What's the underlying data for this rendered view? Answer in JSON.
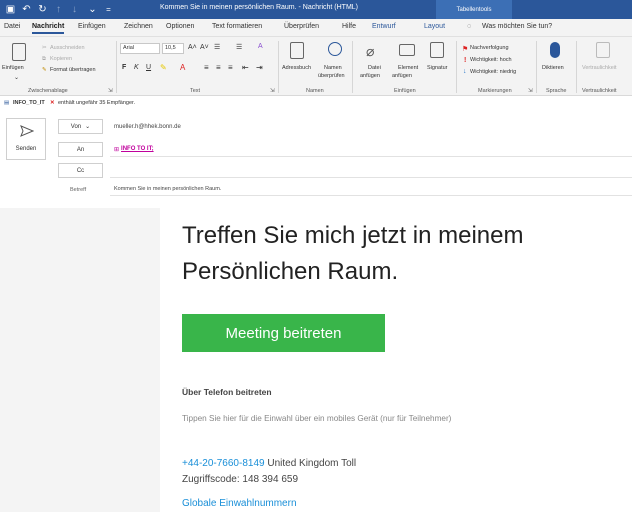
{
  "window": {
    "title": "Kommen Sie in meinen persönlichen Raum.  -  Nachricht (HTML)",
    "tool_tab": "Tabellentools"
  },
  "tabs": [
    "Datei",
    "Nachricht",
    "Einfügen",
    "Zeichnen",
    "Optionen",
    "Text formatieren",
    "Überprüfen",
    "Hilfe",
    "Entwurf",
    "Layout"
  ],
  "tell_me": "Was möchten Sie tun?",
  "ribbon": {
    "clipboard": {
      "paste": "Einfügen",
      "cut": "Ausschneiden",
      "copy": "Kopieren",
      "format_painter": "Format übertragen",
      "group": "Zwischenablage"
    },
    "text": {
      "font": "Arial",
      "size": "10,5",
      "bold": "F",
      "italic": "K",
      "underline": "U",
      "group": "Text"
    },
    "names": {
      "address_book": "Adressbuch",
      "check_names_1": "Namen",
      "check_names_2": "überprüfen",
      "group": "Namen"
    },
    "include": {
      "file_1": "Datei",
      "file_2": "anfügen",
      "element_1": "Element",
      "element_2": "anfügen",
      "signature": "Signatur",
      "group": "Einfügen"
    },
    "tags": {
      "followup": "Nachverfolgung",
      "high": "Wichtigkeit: hoch",
      "low": "Wichtigkeit: niedrig",
      "group": "Markierungen"
    },
    "speech": {
      "dictate": "Diktieren",
      "group": "Sprache"
    },
    "sensitivity": {
      "label": "Vertraulichkeit",
      "group": "Vertraulichkeit"
    }
  },
  "infobar": {
    "name": "INFO_TO_IT",
    "text": "enthält ungefähr 35 Empfänger."
  },
  "compose": {
    "send": "Senden",
    "from_btn": "Von",
    "from_value": "mueller.h@hhek.bonn.de",
    "to_btn": "An",
    "to_value": "INFO TO IT;",
    "cc_btn": "Cc",
    "subject_label": "Betreff",
    "subject_value": "Kommen Sie in meinen persönlichen Raum."
  },
  "body": {
    "heading_line1": "Treffen Sie mich jetzt in meinem",
    "heading_line2": "Persönlichen Raum.",
    "join_button": "Meeting beitreten",
    "phone_heading": "Über Telefon beitreten",
    "tip": "Tippen Sie hier für die Einwahl über ein mobiles Gerät (nur für Teilnehmer)",
    "phone_number": "+44-20-7660-8149",
    "phone_region": "United Kingdom Toll",
    "access_code": "Zugriffscode: 148 394 659",
    "global_numbers": "Globale Einwahlnummern"
  },
  "colors": {
    "accent": "#2b579a",
    "join_button": "#39b54a",
    "link": "#1a8fd8",
    "recipient": "#c0009c"
  }
}
